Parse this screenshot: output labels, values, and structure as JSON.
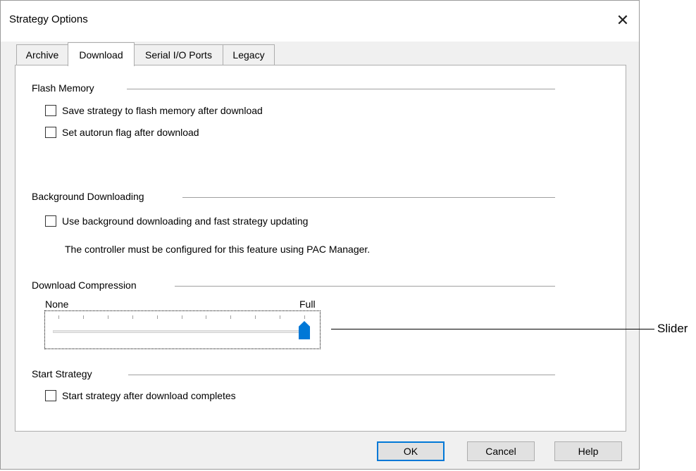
{
  "window": {
    "title": "Strategy Options",
    "close_glyph": "✕"
  },
  "tabs": [
    {
      "label": "Archive",
      "active": false
    },
    {
      "label": "Download",
      "active": true
    },
    {
      "label": "Serial I/O Ports",
      "active": false
    },
    {
      "label": "Legacy",
      "active": false
    }
  ],
  "flash_memory": {
    "title": "Flash Memory",
    "options": [
      {
        "label": "Save strategy to flash memory after download",
        "checked": false
      },
      {
        "label": "Set autorun flag after download",
        "checked": false
      }
    ]
  },
  "background_downloading": {
    "title": "Background Downloading",
    "option": {
      "label": "Use background downloading and fast strategy updating",
      "checked": false
    },
    "note": "The controller must be configured for this feature using PAC Manager."
  },
  "download_compression": {
    "title": "Download Compression",
    "min_label": "None",
    "max_label": "Full",
    "value_fraction": 1.0,
    "tick_count": 11
  },
  "start_strategy": {
    "title": "Start Strategy",
    "option": {
      "label": "Start strategy after download completes",
      "checked": false
    }
  },
  "buttons": {
    "ok": "OK",
    "cancel": "Cancel",
    "help": "Help"
  },
  "callout": {
    "label": "Slider"
  },
  "colors": {
    "accent": "#0078d7",
    "dialog_bg": "#f0f0f0",
    "panel_bg": "#ffffff"
  }
}
